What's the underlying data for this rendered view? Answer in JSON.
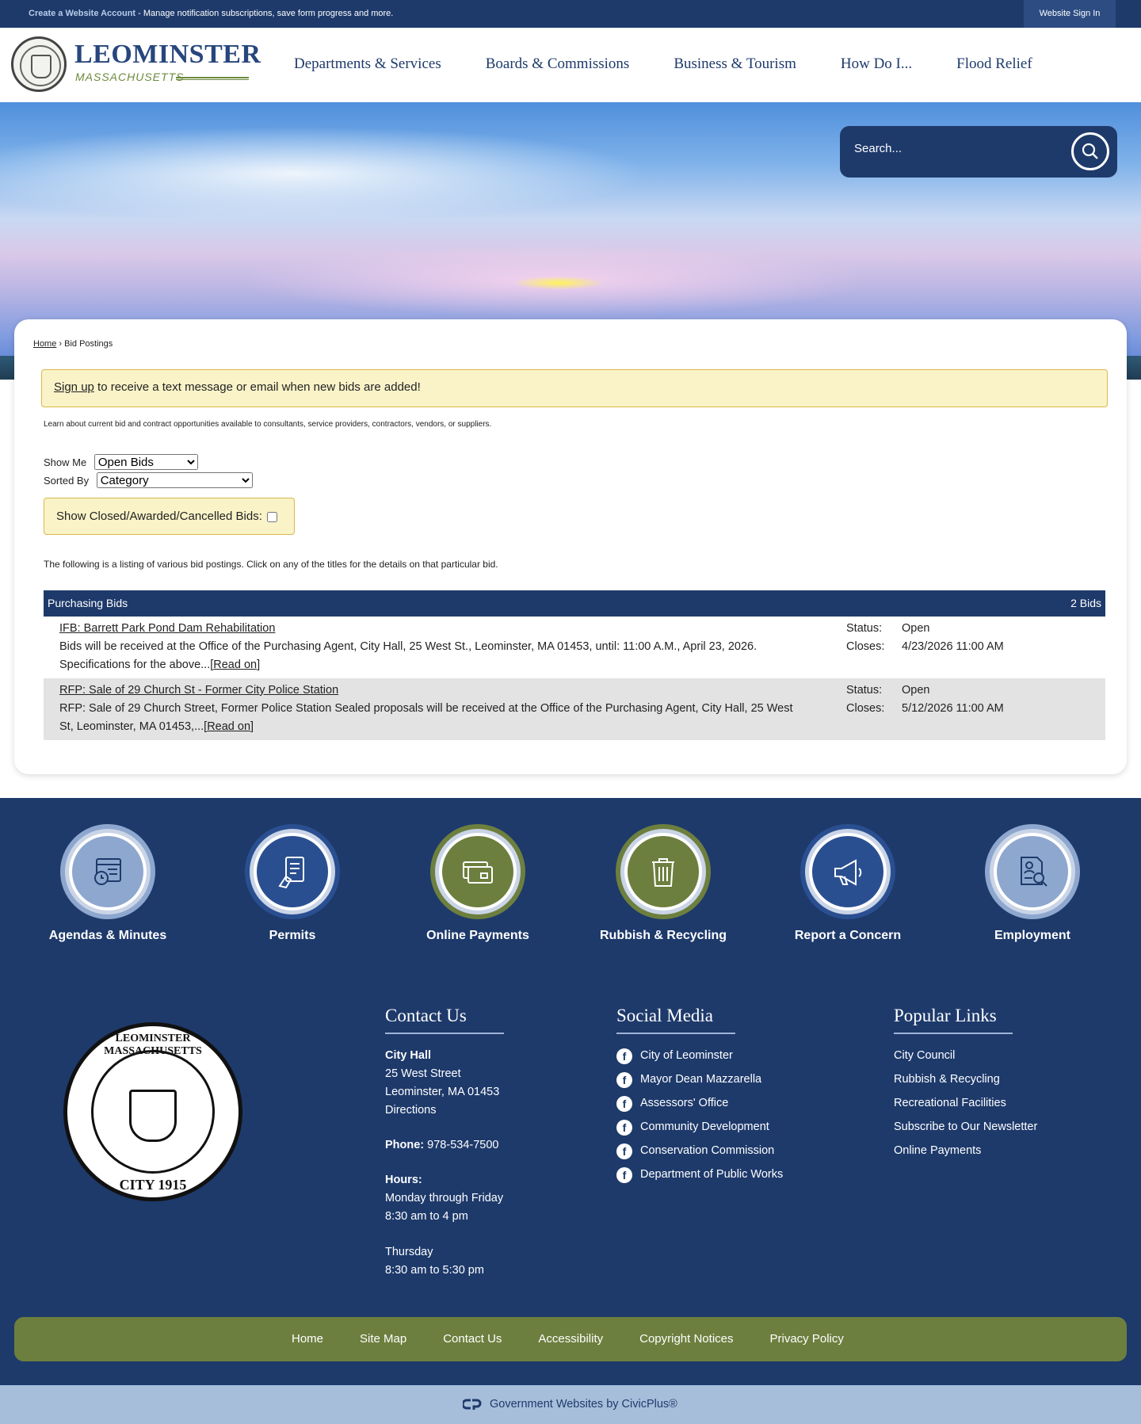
{
  "topbar": {
    "create_link": "Create a Website Account",
    "message": " - Manage notification subscriptions, save form progress and more.",
    "signin": "Website Sign In"
  },
  "logo": {
    "name": "LEOMINSTER",
    "state": "MASSACHUSETTS"
  },
  "nav": [
    "Departments & Services",
    "Boards & Commissions",
    "Business & Tourism",
    "How Do I...",
    "Flood Relief"
  ],
  "search": {
    "placeholder": "Search..."
  },
  "breadcrumb": {
    "home": "Home",
    "sep": " › ",
    "current": "Bid Postings"
  },
  "signup": {
    "link": "Sign up",
    "text": " to receive a text message or email when new bids are added!"
  },
  "intro": "Learn about current bid and contract opportunities available to consultants, service providers, contractors, vendors, or suppliers.",
  "filters": {
    "show_me_label": "Show Me",
    "show_me_value": "Open Bids",
    "sorted_by_label": "Sorted By",
    "sorted_by_value": "Category",
    "closed_label": "Show Closed/Awarded/Cancelled Bids:"
  },
  "listing_note": "The following is a listing of various bid postings. Click on any of the titles for the details on that particular bid.",
  "bids": {
    "category": "Purchasing Bids",
    "count": "2 Bids",
    "items": [
      {
        "title": "IFB: Barrett Park Pond Dam Rehabilitation",
        "description": "Bids will be received at the Office of the Purchasing Agent, City Hall, 25 West St., Leominster, MA 01453, until: 11:00 A.M., April 23, 2026. Specifications for the above...",
        "read_on": "Read on",
        "status_label": "Status:",
        "status": "Open",
        "closes_label": "Closes:",
        "closes": "4/23/2026 11:00 AM"
      },
      {
        "title": "RFP: Sale of 29 Church St - Former City Police Station",
        "description": "RFP: Sale of 29 Church Street, Former Police Station Sealed proposals will be received at the Office of the Purchasing Agent, City Hall, 25 West St, Leominster, MA 01453,...",
        "read_on": "Read on",
        "status_label": "Status:",
        "status": "Open",
        "closes_label": "Closes:",
        "closes": "5/12/2026 11:00 AM"
      }
    ]
  },
  "quick_links": [
    {
      "label": "Agendas & Minutes",
      "icon": "calendar-clock-icon",
      "color": "#8ea7cf"
    },
    {
      "label": "Permits",
      "icon": "permit-hand-icon",
      "color": "#2a4f91"
    },
    {
      "label": "Online Payments",
      "icon": "credit-card-icon",
      "color": "#6d7f3e"
    },
    {
      "label": "Rubbish & Recycling",
      "icon": "trash-can-icon",
      "color": "#6d7f3e"
    },
    {
      "label": "Report a Concern",
      "icon": "megaphone-icon",
      "color": "#2a4f91"
    },
    {
      "label": "Employment",
      "icon": "document-search-icon",
      "color": "#8ea7cf"
    }
  ],
  "seal": {
    "top": "LEOMINSTER MASSACHUSETTS",
    "bottom": "CITY 1915"
  },
  "contact": {
    "heading": "Contact Us",
    "name": "City Hall",
    "street": "25 West Street",
    "city": "Leominster, MA 01453",
    "directions": "Directions",
    "phone_label": "Phone:",
    "phone": " 978-534-7500",
    "hours_label": "Hours:",
    "hours1": "Monday through Friday",
    "hours2": "8:30 am to 4 pm",
    "hours3": "Thursday",
    "hours4": "8:30 am to 5:30 pm"
  },
  "social": {
    "heading": "Social Media",
    "items": [
      "City of Leominster",
      "Mayor Dean Mazzarella",
      "Assessors' Office",
      "Community Development",
      "Conservation Commission",
      "Department of Public Works"
    ]
  },
  "popular": {
    "heading": "Popular Links",
    "items": [
      "City Council",
      "Rubbish & Recycling",
      "Recreational Facilities",
      "Subscribe to Our Newsletter",
      "Online Payments"
    ]
  },
  "bottom_nav": [
    "Home",
    "Site Map",
    "Contact Us",
    "Accessibility",
    "Copyright Notices",
    "Privacy Policy"
  ],
  "credit": "Government Websites by CivicPlus®",
  "colors": {
    "navy": "#1e3a6b",
    "olive": "#6d7f3e",
    "notice_yellow": "#faf3c8"
  }
}
